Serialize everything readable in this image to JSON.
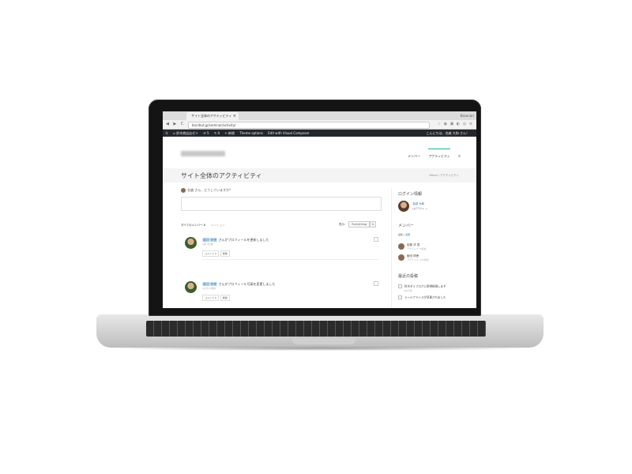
{
  "browser": {
    "tab_title": "サイト全体のアクティビティ",
    "tab_close": "×",
    "profile_name": "Kazunori",
    "url": "bio.tbut.jp/seminar/activity/",
    "nav_buttons": "◀ ▶ C ⌂",
    "ext_icons": "☆ ◉ ▣ ◐ ◎ ≡"
  },
  "adminbar": {
    "wp_logo": "ⓦ",
    "site": "⌂ 鈴木商店店ゼミ",
    "updates": "⟳ 5",
    "comments": "✎ 0",
    "new": "+ 新規",
    "theme_options": "Theme options",
    "visual_composer": "Edit with Visual Composer",
    "greeting": "こんにちは、名越 大和 さん！"
  },
  "header": {
    "menu": {
      "members": "メンバー",
      "activity": "アクティビティ",
      "search_icon": "⚲"
    }
  },
  "title_band": {
    "page_title": "サイト全体のアクティビティ",
    "breadcrumb": "Home / アクティビティ"
  },
  "main": {
    "whats_new": "名越 さん、どうしていますか？",
    "tab_all": "すべてのメンバー 8",
    "tab_mentions": "メンション",
    "filter_label": "表示:",
    "filter_value": "Everything",
    "filter_caret": "▾",
    "activities": [
      {
        "user": "飯田 祥徳",
        "text": "さんがプロフィールを更新しました",
        "time": "1週 4日前",
        "comment_btn": "コメント 0",
        "delete_btn": "削除"
      },
      {
        "user": "飯田 祥徳",
        "text": "さんがプロフィール写真を変更しました",
        "time": "1か月 1週前",
        "comment_btn": "コメント 0",
        "delete_btn": "削除"
      }
    ]
  },
  "sidebar": {
    "login_heading": "ログイン情報",
    "me_name": "名越 大和",
    "me_logout": "ログアウト →",
    "members_heading": "メンバー",
    "members_tabs": {
      "newest": "最新",
      "sep": " | ",
      "active": "活発"
    },
    "members": [
      {
        "name": "佐藤 洋 賢",
        "activity": "アクティブ: 8日前"
      },
      {
        "name": "飯田 祥徳",
        "activity": "アクティブ: 1か月前"
      }
    ],
    "recent_posts_heading": "最近の投稿",
    "recent_posts": [
      {
        "title": "鈴木ゼミブログに新規投稿します",
        "date": "2015年"
      },
      {
        "title": "メールアドレスが変更されました",
        "date": ""
      }
    ]
  }
}
